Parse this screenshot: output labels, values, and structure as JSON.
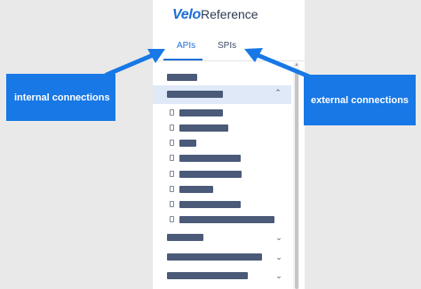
{
  "header": {
    "brand": "Velo",
    "title": "Reference"
  },
  "tabs": [
    {
      "label": "APIs",
      "active": true
    },
    {
      "label": "SPIs",
      "active": false
    }
  ],
  "callouts": {
    "internal": "internal connections",
    "external": "external connections"
  },
  "colors": {
    "accent": "#1d6dd8",
    "callout": "#1778e6",
    "placeholder_bar": "#4a5a78",
    "highlight": "#dfe9f7"
  },
  "icons": [
    "document-icon",
    "chevron-up-icon",
    "chevron-down-icon"
  ]
}
